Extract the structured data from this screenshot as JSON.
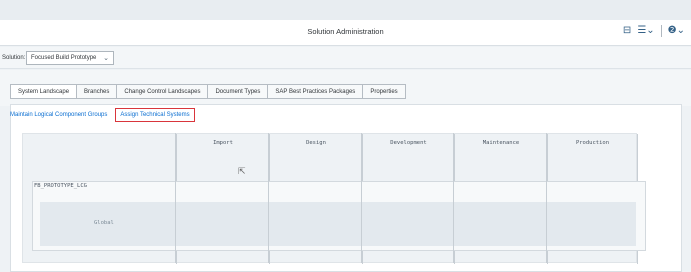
{
  "shell": {
    "title": "Solution Administration",
    "icons": [
      "export-icon",
      "list-menu-icon",
      "help-icon"
    ]
  },
  "solution": {
    "label": "Solution:",
    "selected": "Focused Build Prototype"
  },
  "tabs": [
    {
      "label": "System Landscape",
      "active": true
    },
    {
      "label": "Branches",
      "active": false
    },
    {
      "label": "Change Control Landscapes",
      "active": false
    },
    {
      "label": "Document Types",
      "active": false
    },
    {
      "label": "SAP Best Practices Packages",
      "active": false
    },
    {
      "label": "Properties",
      "active": false
    }
  ],
  "links": {
    "maintain": "Maintain Logical Component Groups",
    "assign": "Assign Technical Systems"
  },
  "grid": {
    "columns": [
      "Import",
      "Design",
      "Development",
      "Maintenance",
      "Production"
    ],
    "lcg": "FB_PROTOTYPE_LCG",
    "row": "Global"
  },
  "colors": {
    "accent": "#0a6ed1",
    "highlight": "#d9353b"
  }
}
